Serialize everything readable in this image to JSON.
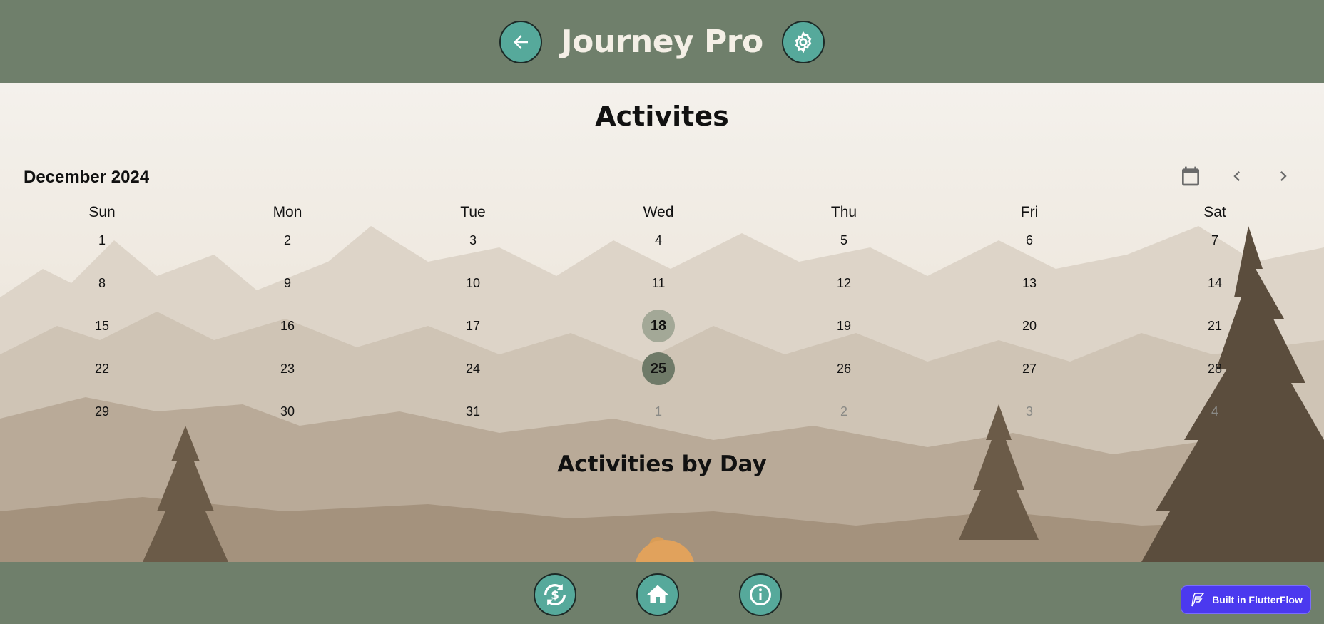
{
  "header": {
    "title": "Journey Pro",
    "back_icon": "arrow-left-icon",
    "settings_icon": "gear-icon"
  },
  "page": {
    "title": "Activites",
    "section_title": "Activities by Day"
  },
  "calendar": {
    "month_label": "December 2024",
    "weekdays": [
      "Sun",
      "Mon",
      "Tue",
      "Wed",
      "Thu",
      "Fri",
      "Sat"
    ],
    "weeks": [
      [
        "1",
        "2",
        "3",
        "4",
        "5",
        "6",
        "7"
      ],
      [
        "8",
        "9",
        "10",
        "11",
        "12",
        "13",
        "14"
      ],
      [
        "15",
        "16",
        "17",
        "18",
        "19",
        "20",
        "21"
      ],
      [
        "22",
        "23",
        "24",
        "25",
        "26",
        "27",
        "28"
      ],
      [
        "29",
        "30",
        "31",
        "1",
        "2",
        "3",
        "4"
      ]
    ],
    "selected_day": "18",
    "today": "25"
  },
  "footer": {
    "sync_icon": "sync-dollar-icon",
    "home_icon": "home-icon",
    "info_icon": "info-icon"
  },
  "badge": {
    "label": "Built in FlutterFlow"
  },
  "colors": {
    "bar": "#6f7f6b",
    "accent": "#56a99b",
    "background": "#f3f0ea",
    "badge": "#4b39ef"
  }
}
